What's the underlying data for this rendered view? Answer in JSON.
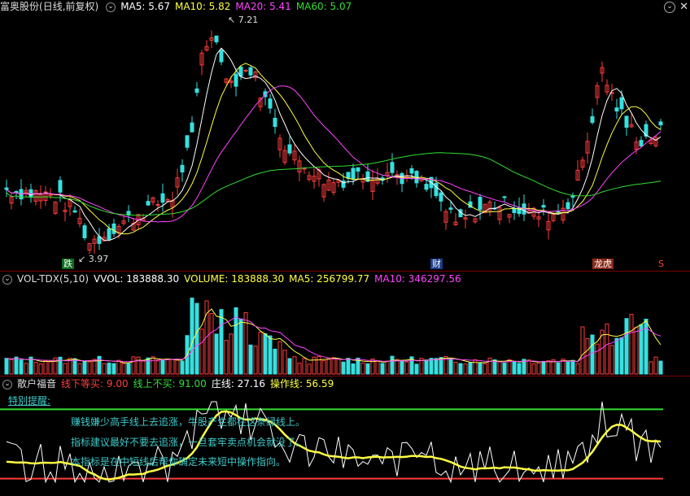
{
  "header": {
    "stock_name": "富奥股份",
    "period": "(日线,前复权)",
    "ma5": "MA5: 5.67",
    "ma10": "MA10: 5.82",
    "ma20": "MA20: 5.41",
    "ma60": "MA60: 5.07"
  },
  "price_chart": {
    "high_label": "7.21",
    "low_label": "3.97",
    "markers": {
      "fall": "跌",
      "finance": "财",
      "dragon_tiger": "龙虎",
      "s": "S"
    }
  },
  "volume_panel": {
    "indicator": "VOL-TDX(5,10)",
    "vvol": "VVOL: 183888.30",
    "volume": "VOLUME: 183888.30",
    "ma5": "MA5: 256799.77",
    "ma10": "MA10: 346297.56"
  },
  "retail_panel": {
    "name": "散户福音",
    "line_down": "线下等买: 9.00",
    "line_up": "线上不买: 91.00",
    "dealer": "庄线: 27.16",
    "operation": "操作线: 56.59",
    "tip_title": "特别提醒:",
    "tips": [
      "赚钱嫌少高手线上去追涨，牛股产生都在这条绿线上。",
      "指标建议最好不要去追涨，一旦套牢卖点机会就没了。",
      "本指标是在中短线后帮你确定未来短中操作指向。"
    ]
  },
  "colors": {
    "up": "#ff3b3b",
    "down": "#36e0e0",
    "ma5": "#ffffff",
    "ma10": "#ffff44",
    "ma20": "#ff44ff",
    "ma60": "#33dd33"
  }
}
